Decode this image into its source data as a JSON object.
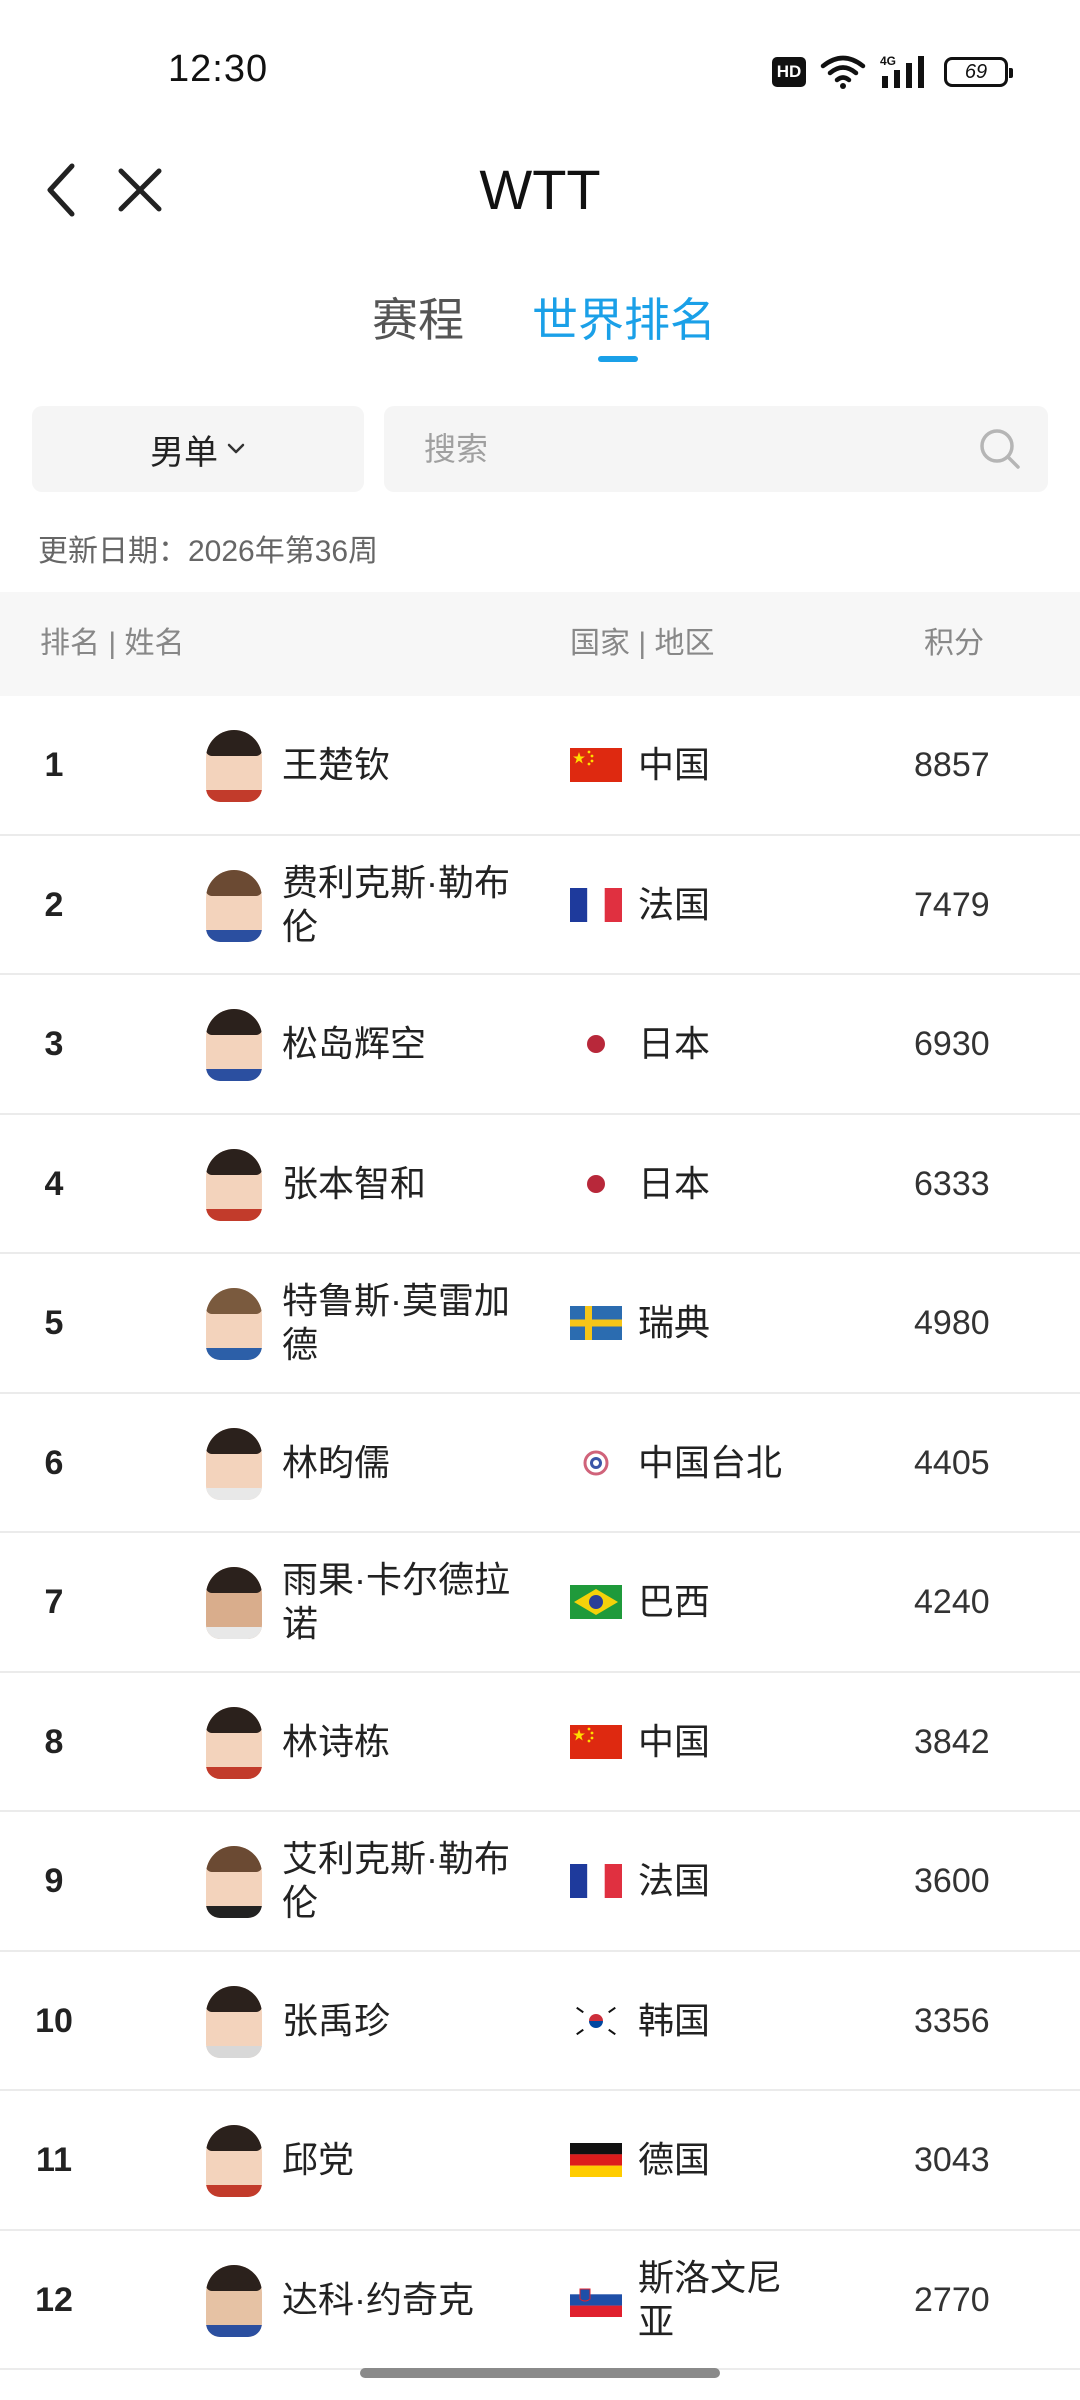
{
  "status_bar": {
    "time": "12:30",
    "network": "4G",
    "battery": "69"
  },
  "nav": {
    "title": "WTT",
    "back_icon": "chevron-left-icon",
    "close_icon": "close-icon"
  },
  "tabs": [
    {
      "label": "赛程",
      "active": false
    },
    {
      "label": "世界排名",
      "active": true
    }
  ],
  "accent_color": "#1aa0e8",
  "filters": {
    "category": "男单",
    "search_placeholder": "搜索"
  },
  "update_date": "更新日期：2026年第36周",
  "table": {
    "headers": {
      "rank_name": "排名 | 姓名",
      "country": "国家 | 地区",
      "points": "积分"
    },
    "rows": [
      {
        "rank": "1",
        "name": "王楚钦",
        "country": "中国",
        "flag": "china",
        "points": "8857"
      },
      {
        "rank": "2",
        "name": "费利克斯·勒布伦",
        "country": "法国",
        "flag": "france",
        "points": "7479"
      },
      {
        "rank": "3",
        "name": "松岛辉空",
        "country": "日本",
        "flag": "japan",
        "points": "6930"
      },
      {
        "rank": "4",
        "name": "张本智和",
        "country": "日本",
        "flag": "japan",
        "points": "6333"
      },
      {
        "rank": "5",
        "name": "特鲁斯·莫雷加德",
        "country": "瑞典",
        "flag": "sweden",
        "points": "4980"
      },
      {
        "rank": "6",
        "name": "林昀儒",
        "country": "中国台北",
        "flag": "chinese-taipei",
        "points": "4405"
      },
      {
        "rank": "7",
        "name": "雨果·卡尔德拉诺",
        "country": "巴西",
        "flag": "brazil",
        "points": "4240"
      },
      {
        "rank": "8",
        "name": "林诗栋",
        "country": "中国",
        "flag": "china",
        "points": "3842"
      },
      {
        "rank": "9",
        "name": "艾利克斯·勒布伦",
        "country": "法国",
        "flag": "france",
        "points": "3600"
      },
      {
        "rank": "10",
        "name": "张禹珍",
        "country": "韩国",
        "flag": "korea",
        "points": "3356"
      },
      {
        "rank": "11",
        "name": "邱党",
        "country": "德国",
        "flag": "germany",
        "points": "3043"
      },
      {
        "rank": "12",
        "name": "达科·约奇克",
        "country": "斯洛文尼亚",
        "flag": "slovenia",
        "points": "2770"
      }
    ]
  }
}
